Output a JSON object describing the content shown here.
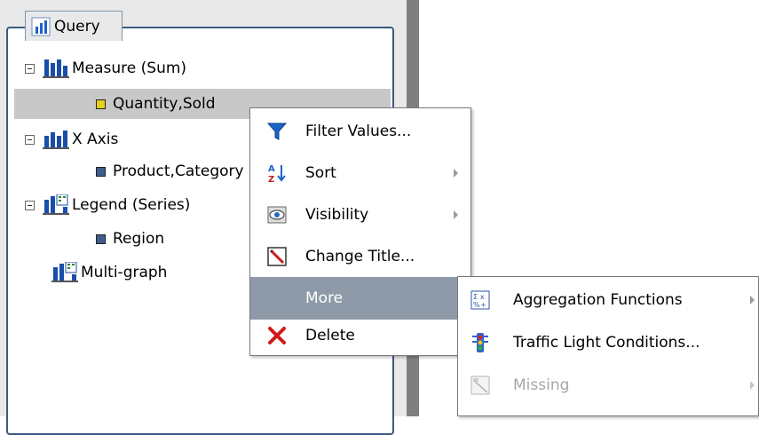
{
  "panel": {
    "tab_label": "Query",
    "tree": [
      {
        "label": "Measure (Sum)",
        "icon": "bar-chart-icon"
      },
      {
        "label": "Quantity,Sold",
        "icon": "yellow-square-icon"
      },
      {
        "label": "X Axis",
        "icon": "bar-chart-icon"
      },
      {
        "label": "Product,Category",
        "icon": "blue-square-icon"
      },
      {
        "label": "Legend (Series)",
        "icon": "legend-chart-icon"
      },
      {
        "label": "Region",
        "icon": "blue-square-icon"
      },
      {
        "label": "Multi-graph",
        "icon": "legend-chart-icon"
      }
    ]
  },
  "context_menu": {
    "items": [
      {
        "label": "Filter Values...",
        "icon": "funnel-icon"
      },
      {
        "label": "Sort",
        "icon": "sort-az-icon"
      },
      {
        "label": "Visibility",
        "icon": "eye-icon"
      },
      {
        "label": "Change Title...",
        "icon": "pencil-icon"
      },
      {
        "label": "More"
      },
      {
        "label": "Delete",
        "icon": "delete-x-icon"
      }
    ]
  },
  "submenu": {
    "items": [
      {
        "label": "Aggregation Functions",
        "icon": "aggregation-icon"
      },
      {
        "label": "Traffic Light Conditions...",
        "icon": "traffic-light-icon"
      },
      {
        "label": "Missing",
        "icon": "missing-icon"
      }
    ]
  },
  "colors": {
    "menu_highlight": "#8e9aa8",
    "frame_border": "#3a5a82",
    "splitter": "#7f7f7f"
  }
}
